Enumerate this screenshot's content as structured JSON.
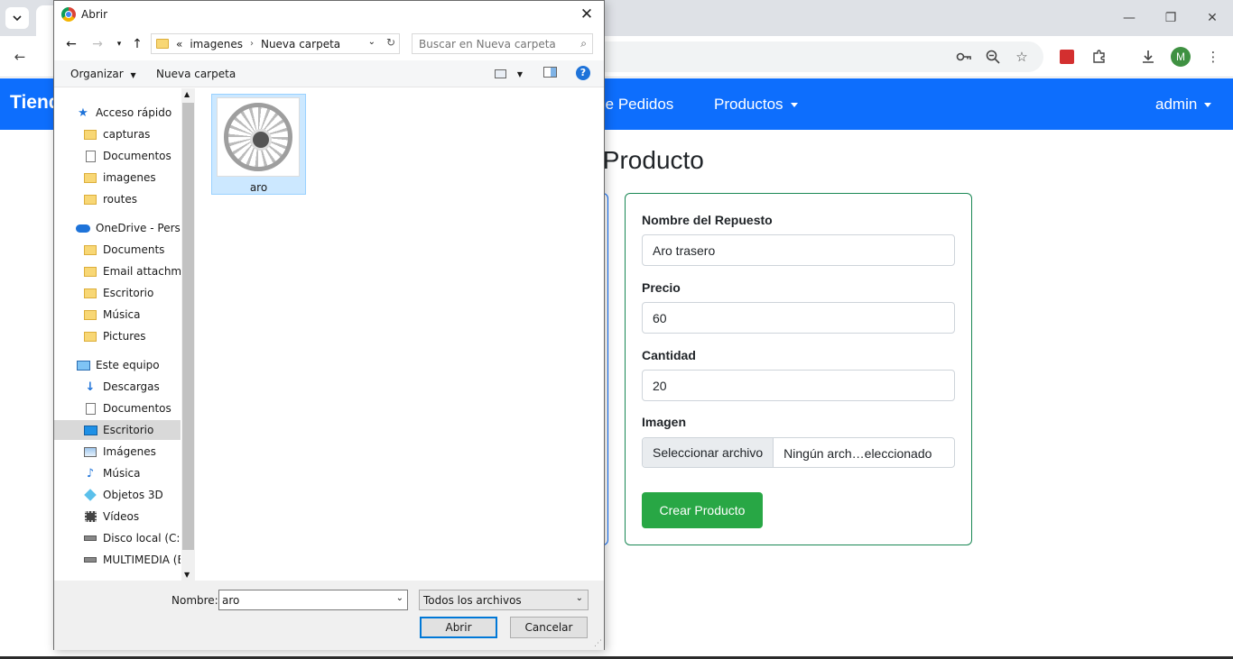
{
  "browser": {
    "icons": [
      "tab-list-icon",
      "back-icon",
      "key-icon",
      "zoom-out-icon",
      "star-icon",
      "extension-red-icon",
      "puzzle-icon",
      "download-icon",
      "menu-icon"
    ],
    "profile_initial": "M",
    "window_controls": {
      "minimize": "—",
      "restore": "❐",
      "close": "✕"
    }
  },
  "navbar": {
    "brand": "Tienda",
    "links": [
      "Reporte de Pedidos",
      "Productos"
    ],
    "user": "admin",
    "color": "#0d6efd"
  },
  "page": {
    "title": "Crear Producto",
    "form": {
      "name_label": "Nombre del Repuesto",
      "name_value": "Aro trasero",
      "price_label": "Precio",
      "price_value": "60",
      "qty_label": "Cantidad",
      "qty_value": "20",
      "image_label": "Imagen",
      "file_button": "Seleccionar archivo",
      "file_status": "Ningún arch…eleccionado",
      "submit": "Crear Producto",
      "accent": "#28a745"
    }
  },
  "dialog": {
    "title": "Abrir",
    "close": "✕",
    "address": {
      "prefix": "«",
      "segments": [
        "imagenes",
        "Nueva carpeta"
      ]
    },
    "search_placeholder": "Buscar en Nueva carpeta",
    "commands": {
      "organize": "Organizar",
      "new_folder": "Nueva carpeta"
    },
    "nav_tree": [
      {
        "label": "Acceso rápido",
        "icon": "star-icon",
        "indent": 0
      },
      {
        "label": "capturas",
        "icon": "folder-icon",
        "indent": 1
      },
      {
        "label": "Documentos",
        "icon": "document-icon",
        "indent": 1
      },
      {
        "label": "imagenes",
        "icon": "folder-icon",
        "indent": 1
      },
      {
        "label": "routes",
        "icon": "folder-icon",
        "indent": 1
      },
      {
        "label": "OneDrive - Personal",
        "icon": "cloud-icon",
        "indent": 0
      },
      {
        "label": "Documents",
        "icon": "folder-icon",
        "indent": 1
      },
      {
        "label": "Email attachments",
        "icon": "folder-icon",
        "indent": 1
      },
      {
        "label": "Escritorio",
        "icon": "folder-icon",
        "indent": 1
      },
      {
        "label": "Música",
        "icon": "folder-icon",
        "indent": 1
      },
      {
        "label": "Pictures",
        "icon": "folder-icon",
        "indent": 1
      },
      {
        "label": "Este equipo",
        "icon": "computer-icon",
        "indent": 0
      },
      {
        "label": "Descargas",
        "icon": "download-icon",
        "indent": 1
      },
      {
        "label": "Documentos",
        "icon": "document-icon",
        "indent": 1
      },
      {
        "label": "Escritorio",
        "icon": "desktop-icon",
        "indent": 1,
        "selected": true
      },
      {
        "label": "Imágenes",
        "icon": "image-icon",
        "indent": 1
      },
      {
        "label": "Música",
        "icon": "music-icon",
        "indent": 1
      },
      {
        "label": "Objetos 3D",
        "icon": "cube-icon",
        "indent": 1
      },
      {
        "label": "Vídeos",
        "icon": "video-icon",
        "indent": 1
      },
      {
        "label": "Disco local (C:)",
        "icon": "drive-icon",
        "indent": 1
      },
      {
        "label": "MULTIMEDIA (E:)",
        "icon": "drive-icon",
        "indent": 1
      }
    ],
    "files": [
      {
        "name": "aro",
        "selected": true
      }
    ],
    "filename_label": "Nombre:",
    "filename_value": "aro",
    "filetype": "Todos los archivos",
    "open_button": "Abrir",
    "cancel_button": "Cancelar"
  }
}
